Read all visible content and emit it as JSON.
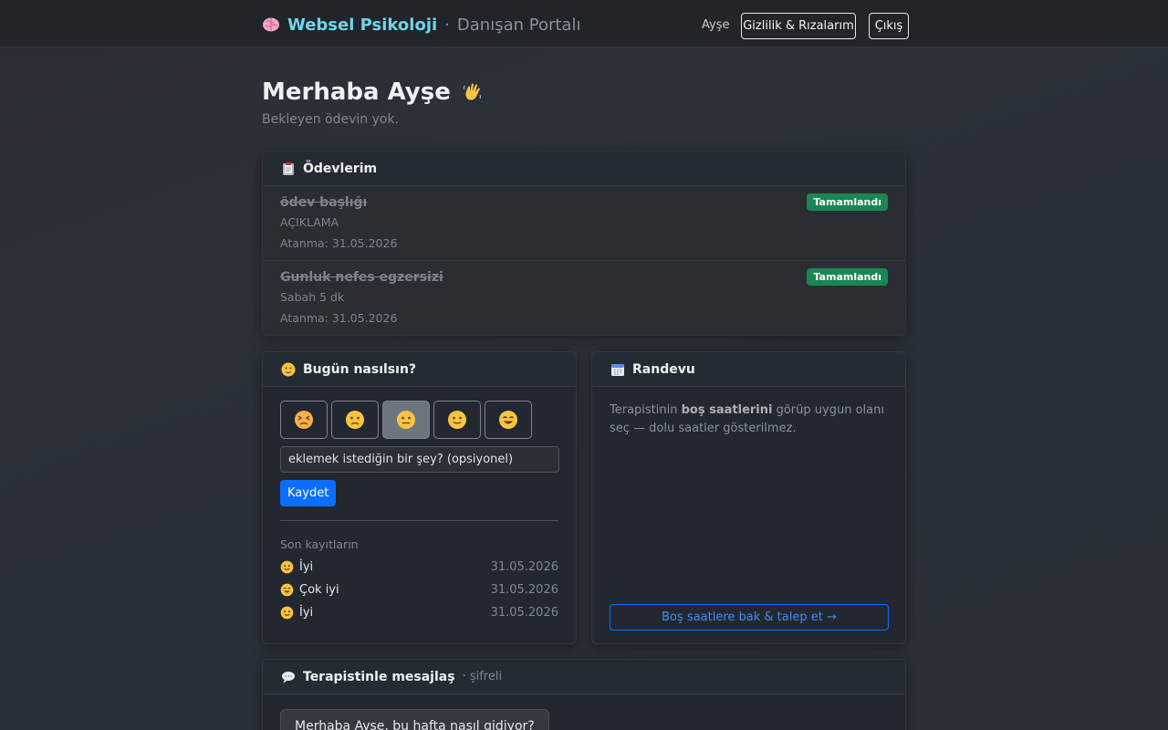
{
  "nav": {
    "brand_name": "Websel Psikoloji",
    "brand_sep": "·",
    "brand_sub": "Danışan Portalı",
    "user": "Ayşe",
    "privacy_label": "Gizlilik & Rızalarım",
    "logout_label": "Çıkış"
  },
  "greeting": {
    "title": "Merhaba Ayşe",
    "subtitle": "Bekleyen ödevin yok."
  },
  "assignments": {
    "header": "Ödevlerim",
    "items": [
      {
        "title": "ödev başlığı",
        "description": "AÇIKLAMA",
        "assigned": "Atanma: 31.05.2026",
        "status": "Tamamlandı"
      },
      {
        "title": "Gunluk nefes egzersizi",
        "description": "Sabah 5 dk",
        "assigned": "Atanma: 31.05.2026",
        "status": "Tamamlandı"
      }
    ]
  },
  "mood": {
    "header": "Bugün nasılsın?",
    "options": [
      "very-bad-face-icon",
      "bad-face-icon",
      "neutral-face-icon",
      "good-face-icon",
      "very-good-face-icon"
    ],
    "selected_index": 2,
    "note_placeholder": "eklemek istediğin bir şey? (opsiyonel)",
    "save_label": "Kaydet",
    "recent_label": "Son kayıtların",
    "recent": [
      {
        "label": "İyi",
        "date": "31.05.2026"
      },
      {
        "label": "Çok iyi",
        "date": "31.05.2026"
      },
      {
        "label": "İyi",
        "date": "31.05.2026"
      }
    ]
  },
  "appointment": {
    "header": "Randevu",
    "text_prefix": "Terapistinin ",
    "text_bold": "boş saatlerini",
    "text_suffix": " görüp uygun olanı seç — dolu saatler gösterilmez.",
    "button_label": "Boş saatlere bak & talep et →"
  },
  "messages": {
    "header": "Terapistinle mesajlaş",
    "header_muted": "· şifreli",
    "first_message": "Merhaba Ayşe, bu hafta nasıl gidiyor?"
  },
  "colors": {
    "accent": "#0d6efd",
    "success": "#198754",
    "brand": "#6fd6e9"
  }
}
